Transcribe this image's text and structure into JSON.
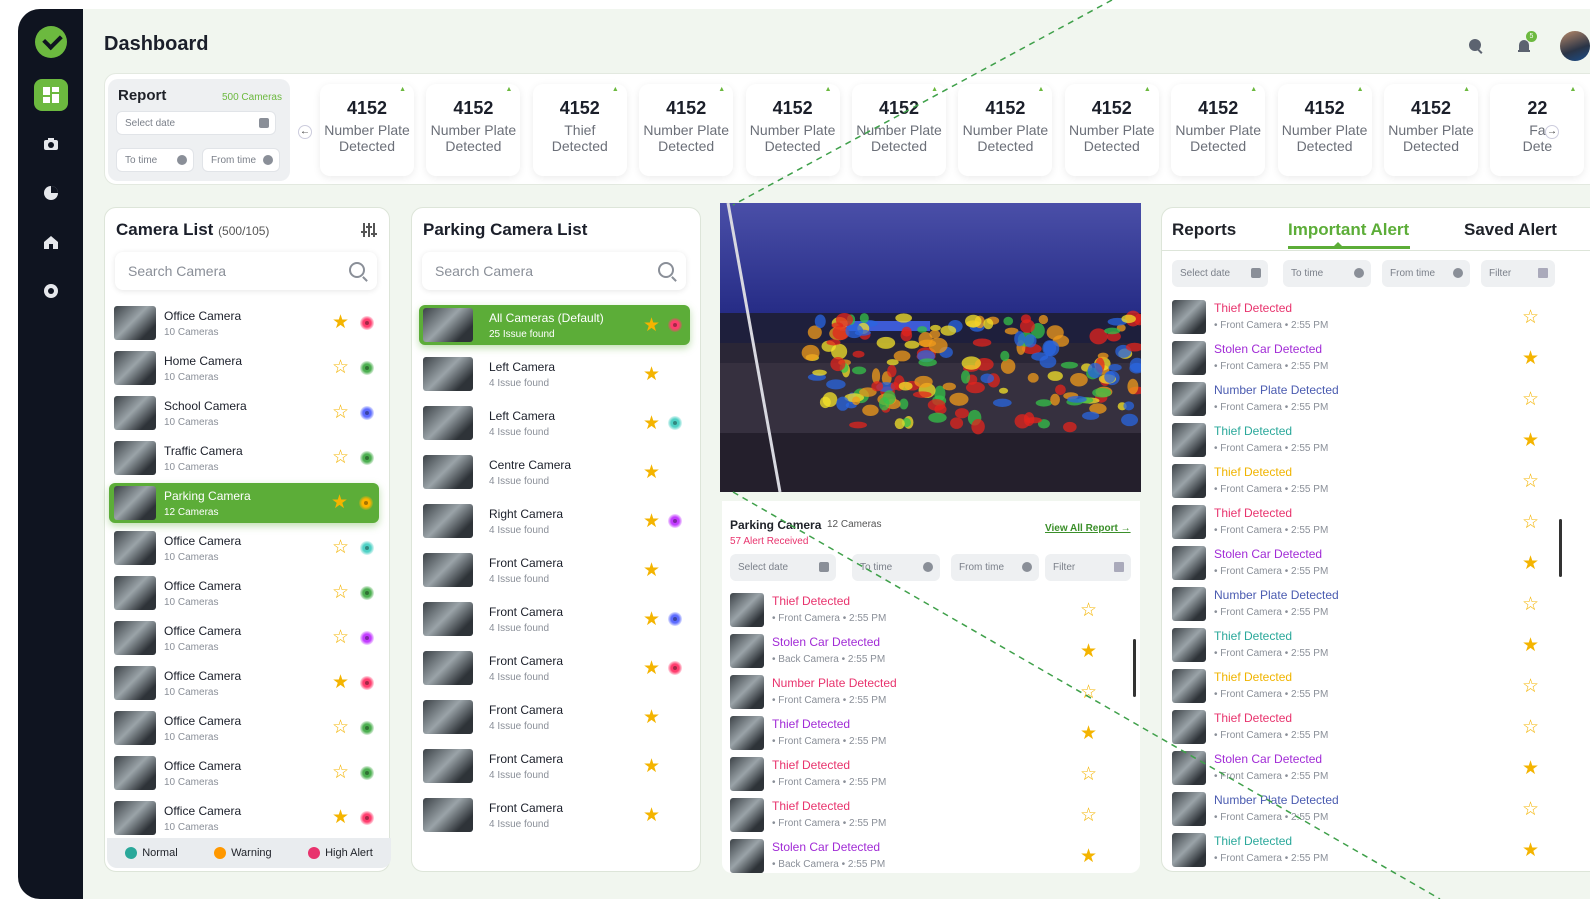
{
  "page": {
    "title": "Dashboard",
    "notif_count": "5"
  },
  "sidebar": {
    "items": [
      {
        "name": "dashboard"
      },
      {
        "name": "camera"
      },
      {
        "name": "analytics"
      },
      {
        "name": "home"
      },
      {
        "name": "settings"
      }
    ]
  },
  "report": {
    "title": "Report",
    "cameras": "500 Cameras",
    "select_date": "Select date",
    "to_time": "To time",
    "from_time": "From time",
    "prev": "←",
    "next": "→"
  },
  "stats": [
    {
      "num": "4152",
      "line1": "Number Plate",
      "line2": "Detected"
    },
    {
      "num": "4152",
      "line1": "Number Plate",
      "line2": "Detected"
    },
    {
      "num": "4152",
      "line1": "Thief",
      "line2": "Detected"
    },
    {
      "num": "4152",
      "line1": "Number Plate",
      "line2": "Detected"
    },
    {
      "num": "4152",
      "line1": "Number Plate",
      "line2": "Detected"
    },
    {
      "num": "4152",
      "line1": "Number Plate",
      "line2": "Detected"
    },
    {
      "num": "4152",
      "line1": "Number Plate",
      "line2": "Detected"
    },
    {
      "num": "4152",
      "line1": "Number Plate",
      "line2": "Detected"
    },
    {
      "num": "4152",
      "line1": "Number Plate",
      "line2": "Detected"
    },
    {
      "num": "4152",
      "line1": "Number Plate",
      "line2": "Detected"
    },
    {
      "num": "4152",
      "line1": "Number Plate",
      "line2": "Detected"
    },
    {
      "num": "22",
      "line1": "Fa",
      "line2": "Dete"
    }
  ],
  "camera_list": {
    "title": "Camera List",
    "count": "(500/105)",
    "search": "Search Camera",
    "items": [
      {
        "name": "Office Camera",
        "sub": "10 Cameras",
        "star": "★",
        "dot": "#ff3d6e"
      },
      {
        "name": "Home Camera",
        "sub": "10 Cameras",
        "star": "☆",
        "dot": "#4caf50"
      },
      {
        "name": "School Camera",
        "sub": "10 Cameras",
        "star": "☆",
        "dot": "#5c6bff"
      },
      {
        "name": "Traffic Camera",
        "sub": "10 Cameras",
        "star": "☆",
        "dot": "#4caf50"
      },
      {
        "name": "Parking Camera",
        "sub": "12 Cameras",
        "star": "★",
        "dot": "#ffb300"
      },
      {
        "name": "Office Camera",
        "sub": "10 Cameras",
        "star": "☆",
        "dot": "#4fd1c5"
      },
      {
        "name": "Office Camera",
        "sub": "10 Cameras",
        "star": "☆",
        "dot": "#4caf50"
      },
      {
        "name": "Office Camera",
        "sub": "10 Cameras",
        "star": "☆",
        "dot": "#c23cff"
      },
      {
        "name": "Office Camera",
        "sub": "10 Cameras",
        "star": "★",
        "dot": "#ff3d6e"
      },
      {
        "name": "Office Camera",
        "sub": "10 Cameras",
        "star": "☆",
        "dot": "#4caf50"
      },
      {
        "name": "Office Camera",
        "sub": "10 Cameras",
        "star": "☆",
        "dot": "#4caf50"
      },
      {
        "name": "Office Camera",
        "sub": "10 Cameras",
        "star": "★",
        "dot": "#ff3d6e"
      }
    ],
    "legend": {
      "normal": "Normal",
      "warning": "Warning",
      "high": "High Alert"
    }
  },
  "parking_list": {
    "title": "Parking Camera List",
    "search": "Search Camera",
    "items": [
      {
        "name": "All Cameras  (Default)",
        "sub": "25 Issue found",
        "star": "★",
        "dot": "#ff3d6e"
      },
      {
        "name": "Left Camera",
        "sub": "4 Issue found",
        "star": "★",
        "dot": ""
      },
      {
        "name": "Left Camera",
        "sub": "4 Issue found",
        "star": "★",
        "dot": "#4fd1c5"
      },
      {
        "name": "Centre Camera",
        "sub": "4 Issue found",
        "star": "★",
        "dot": ""
      },
      {
        "name": "Right Camera",
        "sub": "4 Issue found",
        "star": "★",
        "dot": "#c23cff"
      },
      {
        "name": "Front Camera",
        "sub": "4 Issue found",
        "star": "★",
        "dot": ""
      },
      {
        "name": "Front Camera",
        "sub": "4 Issue found",
        "star": "★",
        "dot": "#5c6bff"
      },
      {
        "name": "Front Camera",
        "sub": "4 Issue found",
        "star": "★",
        "dot": "#ff3d6e"
      },
      {
        "name": "Front Camera",
        "sub": "4 Issue found",
        "star": "★",
        "dot": ""
      },
      {
        "name": "Front Camera",
        "sub": "4 Issue found",
        "star": "★",
        "dot": ""
      },
      {
        "name": "Front Camera",
        "sub": "4 Issue found",
        "star": "★",
        "dot": ""
      }
    ]
  },
  "feed": {
    "name": "Parking Camera",
    "cameras": "12 Cameras",
    "alerts": "57 Alert Received",
    "view_all": "View All Report →",
    "filters": {
      "select_date": "Select date",
      "to_time": "To time",
      "from_time": "From time",
      "filter": "Filter"
    },
    "alerts_list": [
      {
        "title": "Thief Detected",
        "color": "#e8336d",
        "cam": "Front Camera",
        "time": "2:55 PM",
        "star": "☆"
      },
      {
        "title": "Stolen Car Detected",
        "color": "#a12bd6",
        "cam": "Back Camera",
        "time": "2:55 PM",
        "star": "★"
      },
      {
        "title": "Number Plate Detected",
        "color": "#e8336d",
        "cam": "Front Camera",
        "time": "2:55 PM",
        "star": "☆"
      },
      {
        "title": "Thief Detected",
        "color": "#a12bd6",
        "cam": "Front Camera",
        "time": "2:55 PM",
        "star": "★"
      },
      {
        "title": "Thief Detected",
        "color": "#e8336d",
        "cam": "Front Camera",
        "time": "2:55 PM",
        "star": "☆"
      },
      {
        "title": "Thief Detected",
        "color": "#e8336d",
        "cam": "Front Camera",
        "time": "2:55 PM",
        "star": "☆"
      },
      {
        "title": "Stolen Car Detected",
        "color": "#a12bd6",
        "cam": "Back Camera",
        "time": "2:55 PM",
        "star": "★"
      }
    ]
  },
  "reports_panel": {
    "tabs": {
      "reports": "Reports",
      "important": "Important Alert",
      "saved": "Saved Alert"
    },
    "filters": {
      "select_date": "Select date",
      "to_time": "To time",
      "from_time": "From time",
      "filter": "Filter"
    },
    "items": [
      {
        "title": "Thief Detected",
        "color": "#e8336d",
        "cam": "Front Camera",
        "time": "2:55 PM",
        "star": "☆"
      },
      {
        "title": "Stolen Car Detected",
        "color": "#a12bd6",
        "cam": "Front Camera",
        "time": "2:55 PM",
        "star": "★"
      },
      {
        "title": "Number Plate Detected",
        "color": "#4a5bb0",
        "cam": "Front Camera",
        "time": "2:55 PM",
        "star": "☆"
      },
      {
        "title": "Thief Detected",
        "color": "#2aa89a",
        "cam": "Front Camera",
        "time": "2:55 PM",
        "star": "★"
      },
      {
        "title": "Thief Detected",
        "color": "#f0b400",
        "cam": "Front Camera",
        "time": "2:55 PM",
        "star": "☆"
      },
      {
        "title": "Thief Detected",
        "color": "#e8336d",
        "cam": "Front Camera",
        "time": "2:55 PM",
        "star": "☆"
      },
      {
        "title": "Stolen Car Detected",
        "color": "#a12bd6",
        "cam": "Front Camera",
        "time": "2:55 PM",
        "star": "★"
      },
      {
        "title": "Number Plate Detected",
        "color": "#4a5bb0",
        "cam": "Front Camera",
        "time": "2:55 PM",
        "star": "☆"
      },
      {
        "title": "Thief Detected",
        "color": "#2aa89a",
        "cam": "Front Camera",
        "time": "2:55 PM",
        "star": "★"
      },
      {
        "title": "Thief Detected",
        "color": "#f0b400",
        "cam": "Front Camera",
        "time": "2:55 PM",
        "star": "☆"
      },
      {
        "title": "Thief Detected",
        "color": "#e8336d",
        "cam": "Front Camera",
        "time": "2:55 PM",
        "star": "☆"
      },
      {
        "title": "Stolen Car Detected",
        "color": "#a12bd6",
        "cam": "Front Camera",
        "time": "2:55 PM",
        "star": "★"
      },
      {
        "title": "Number Plate Detected",
        "color": "#4a5bb0",
        "cam": "Front Camera",
        "time": "2:55 PM",
        "star": "☆"
      },
      {
        "title": "Thief Detected",
        "color": "#2aa89a",
        "cam": "Front Camera",
        "time": "2:55 PM",
        "star": "★"
      }
    ]
  },
  "colors": {
    "accent": "#6cb93f",
    "sidebar": "#0f1420",
    "star": "#f4b400",
    "normal": "#2aa89a",
    "warning": "#ff9800",
    "high": "#e8336d"
  }
}
